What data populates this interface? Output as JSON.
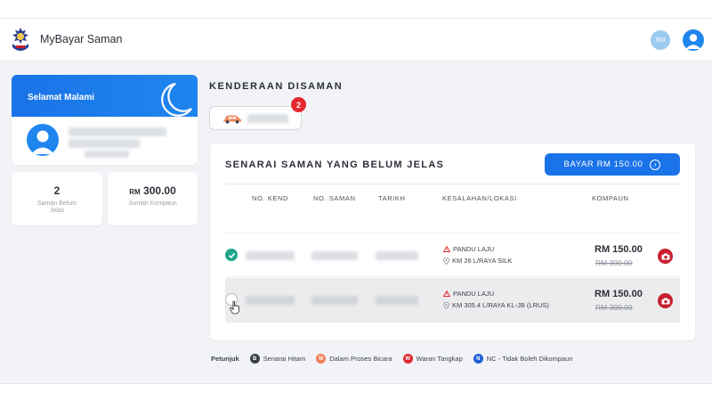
{
  "header": {
    "brand": "MyBayar Saman",
    "user_initials": "RM",
    "logo_icon": "police-crest-icon",
    "avatar_icon": "user-avatar-icon"
  },
  "greeting": {
    "text": "Selamat Malami",
    "icon": "moon-icon"
  },
  "stats": [
    {
      "value": "2",
      "prefix": "",
      "label": "Saman Belum Jelas"
    },
    {
      "value": "300.00",
      "prefix": "RM",
      "label": "Jumlah Kompaun"
    }
  ],
  "section": {
    "title": "KENDERAAN DISAMAN",
    "vehicle_badge": "2",
    "vehicle_icon": "car-icon"
  },
  "list": {
    "title": "SENARAI SAMAN YANG BELUM JELAS",
    "pay_label": "BAYAR RM 150.00",
    "columns": {
      "plate": "NO. KEND",
      "summons": "NO. SAMAN",
      "date": "TARIKH",
      "offense": "KESALAHAN/LOKASI",
      "compound": "KOMPAUN"
    },
    "rows": [
      {
        "selected": true,
        "offense": "PANDU LAJU",
        "location": "KM 26 L/RAYA SILK",
        "amount": "RM 150.00",
        "original_amount": "RM 300.00"
      },
      {
        "selected": false,
        "offense": "PANDU LAJU",
        "location": "KM 305.4 L/RAYA KL-JB (LRUS)",
        "amount": "RM 150.00",
        "original_amount": "RM 300.00"
      }
    ]
  },
  "legend": {
    "label": "Petunjuk",
    "items": [
      {
        "code": "B",
        "text": "Senarai Hitam",
        "color": "#3a3f47"
      },
      {
        "code": "M",
        "text": "Dalam Proses Bicara",
        "color": "#f2805a"
      },
      {
        "code": "W",
        "text": "Waran Tangkap",
        "color": "#e0262f"
      },
      {
        "code": "N",
        "text": "NC - Tidak Boleh Dikompaun",
        "color": "#1f5fd6"
      }
    ]
  },
  "colors": {
    "primary": "#1a73e8",
    "success": "#1fa58c",
    "danger": "#e4282d"
  }
}
